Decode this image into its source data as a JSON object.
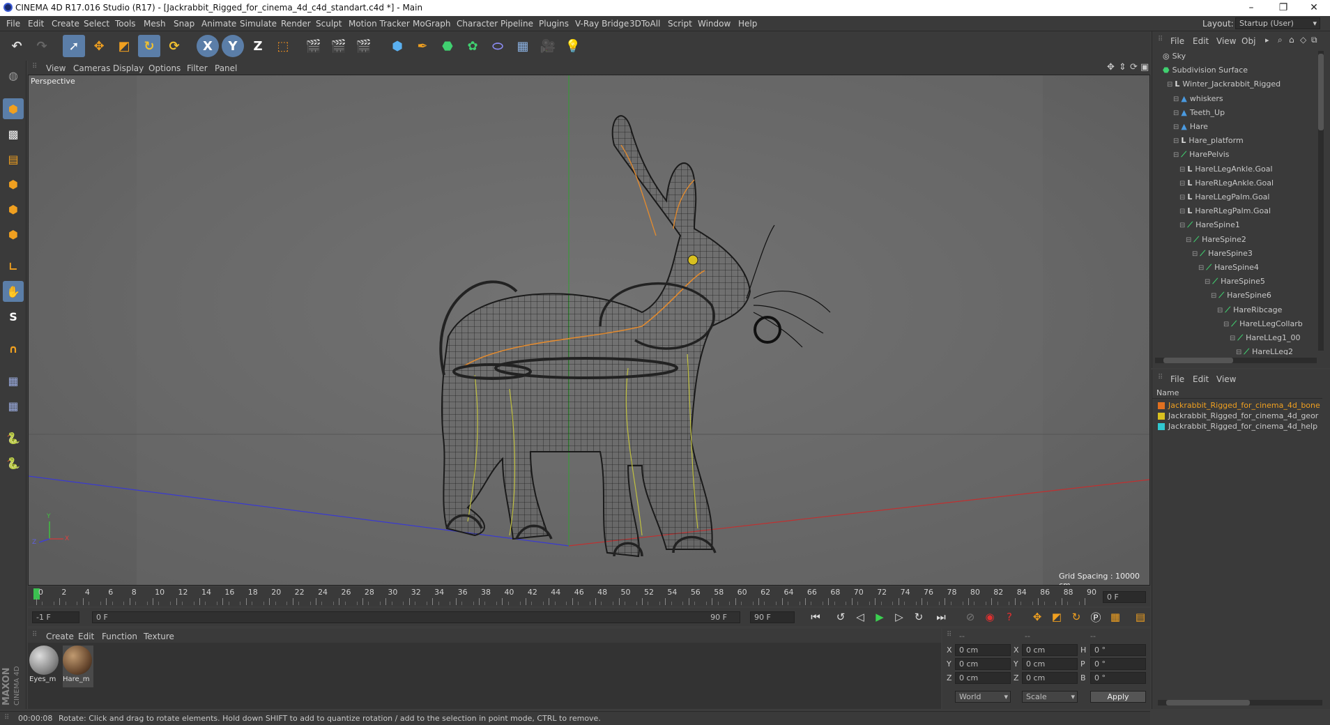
{
  "window": {
    "title": "CINEMA 4D R17.016 Studio (R17) - [Jackrabbit_Rigged_for_cinema_4d_c4d_standart.c4d *] - Main",
    "minimize": "–",
    "restore": "❐",
    "close": "✕"
  },
  "menu": [
    "File",
    "Edit",
    "Create",
    "Select",
    "Tools",
    "Mesh",
    "Snap",
    "Animate",
    "Simulate",
    "Render",
    "Sculpt",
    "Motion Tracker",
    "MoGraph",
    "Character",
    "Pipeline",
    "Plugins",
    "V-Ray Bridge",
    "3DToAll",
    "Script",
    "Window",
    "Help"
  ],
  "layout": {
    "label": "Layout:",
    "value": "Startup (User)"
  },
  "toolbar": {
    "x_label": "X",
    "y_label": "Y",
    "z_label": "Z"
  },
  "left_tools": {
    "s_label": "S"
  },
  "viewport_menu": [
    "View",
    "Cameras",
    "Display",
    "Options",
    "Filter",
    "Panel"
  ],
  "viewport": {
    "label": "Perspective",
    "grid_spacing": "Grid Spacing : 10000 cm",
    "axis_y": "Y",
    "axis_z": "Z",
    "axis_x": "X"
  },
  "timeline": {
    "ticks": [
      "0",
      "2",
      "4",
      "6",
      "8",
      "10",
      "12",
      "14",
      "16",
      "18",
      "20",
      "22",
      "24",
      "26",
      "28",
      "30",
      "32",
      "34",
      "36",
      "38",
      "40",
      "42",
      "44",
      "46",
      "48",
      "50",
      "52",
      "54",
      "56",
      "58",
      "60",
      "62",
      "64",
      "66",
      "68",
      "70",
      "72",
      "74",
      "76",
      "78",
      "80",
      "82",
      "84",
      "86",
      "88",
      "90"
    ],
    "current": "0 F"
  },
  "transport": {
    "start": "-1 F",
    "range_start": "0 F",
    "range_end": "90 F",
    "end": "90 F"
  },
  "material_menu": [
    "Create",
    "Edit",
    "Function",
    "Texture"
  ],
  "materials": [
    {
      "name": "Eyes_m"
    },
    {
      "name": "Hare_m"
    }
  ],
  "coords": {
    "headers": [
      "--",
      "--",
      "--"
    ],
    "rows": [
      {
        "a": "X",
        "av": "0 cm",
        "b": "X",
        "bv": "0 cm",
        "c": "H",
        "cv": "0 °"
      },
      {
        "a": "Y",
        "av": "0 cm",
        "b": "Y",
        "bv": "0 cm",
        "c": "P",
        "cv": "0 °"
      },
      {
        "a": "Z",
        "av": "0 cm",
        "b": "Z",
        "bv": "0 cm",
        "c": "B",
        "cv": "0 °"
      }
    ],
    "world": "World",
    "scale": "Scale",
    "apply": "Apply"
  },
  "status": {
    "time": "00:00:08",
    "message": "Rotate: Click and drag to rotate elements. Hold down SHIFT to add to quantize rotation / add to the selection in point mode, CTRL to remove."
  },
  "object_manager": {
    "menu": [
      "File",
      "Edit",
      "View",
      "Obj"
    ],
    "items": [
      {
        "name": "Sky",
        "indent": 0
      },
      {
        "name": "Subdivision Surface",
        "indent": 0
      },
      {
        "name": "Winter_Jackrabbit_Rigged",
        "indent": 1
      },
      {
        "name": "whiskers",
        "indent": 2
      },
      {
        "name": "Teeth_Up",
        "indent": 2
      },
      {
        "name": "Hare",
        "indent": 2
      },
      {
        "name": "Hare_platform",
        "indent": 2
      },
      {
        "name": "HarePelvis",
        "indent": 2
      },
      {
        "name": "HareLLegAnkle.Goal",
        "indent": 3
      },
      {
        "name": "HareRLegAnkle.Goal",
        "indent": 3
      },
      {
        "name": "HareLLegPalm.Goal",
        "indent": 3
      },
      {
        "name": "HareRLegPalm.Goal",
        "indent": 3
      },
      {
        "name": "HareSpine1",
        "indent": 3
      },
      {
        "name": "HareSpine2",
        "indent": 4
      },
      {
        "name": "HareSpine3",
        "indent": 5
      },
      {
        "name": "HareSpine4",
        "indent": 6
      },
      {
        "name": "HareSpine5",
        "indent": 7
      },
      {
        "name": "HareSpine6",
        "indent": 8
      },
      {
        "name": "HareRibcage",
        "indent": 9
      },
      {
        "name": "HareLLegCollarb",
        "indent": 10
      },
      {
        "name": "HareLLeg1_00",
        "indent": 11
      },
      {
        "name": "HareLLeg2",
        "indent": 12
      }
    ]
  },
  "layer_manager": {
    "menu": [
      "File",
      "Edit",
      "View"
    ],
    "header": "Name",
    "layers": [
      {
        "name": "Jackrabbit_Rigged_for_cinema_4d_bone",
        "color": "#e07020",
        "active": true
      },
      {
        "name": "Jackrabbit_Rigged_for_cinema_4d_geor",
        "color": "#d8c020",
        "active": false
      },
      {
        "name": "Jackrabbit_Rigged_for_cinema_4d_help",
        "color": "#30c8d0",
        "active": false
      }
    ]
  },
  "brand": {
    "maxon": "MAXON",
    "cinema": "CINEMA 4D"
  },
  "colors": {
    "accent": "#3b8de0",
    "viewport_bg": "#6a6a6a"
  }
}
